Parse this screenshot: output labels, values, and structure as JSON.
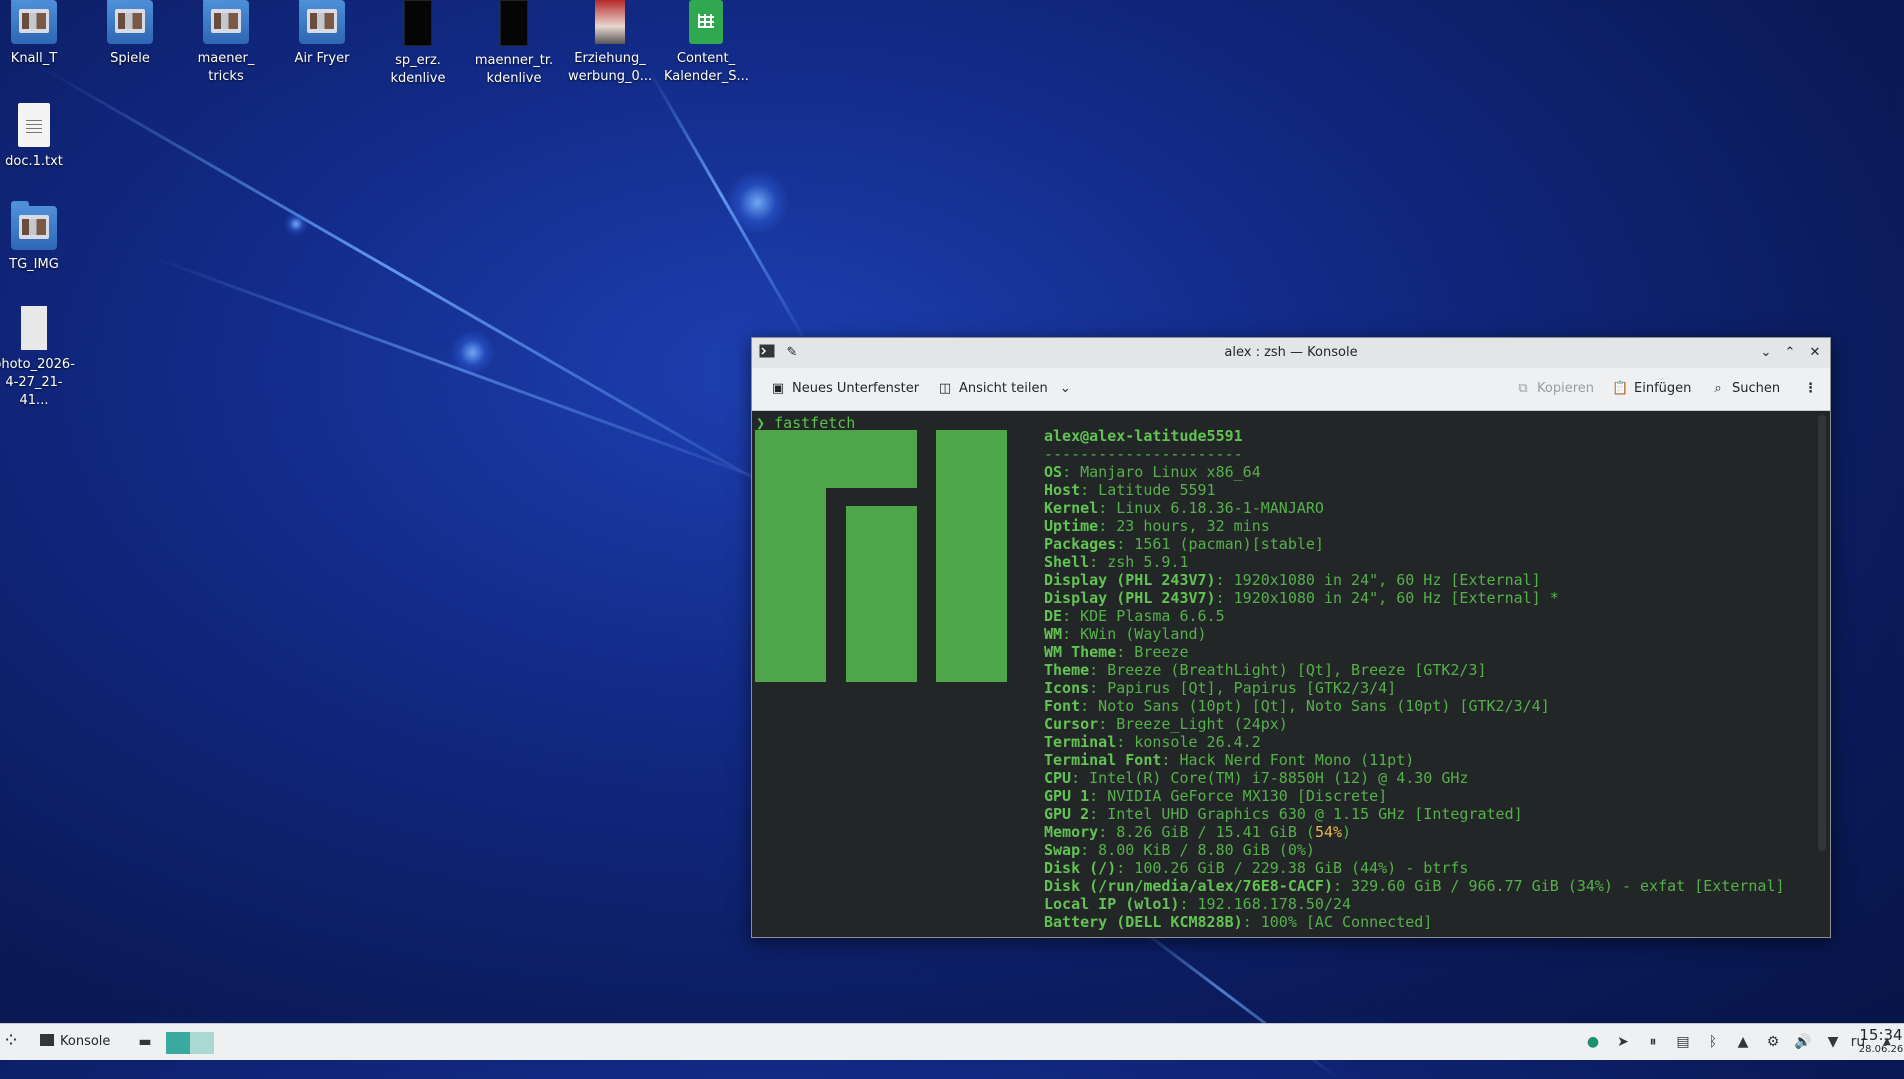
{
  "desktop": {
    "icons": [
      {
        "label": "Knall_T"
      },
      {
        "label": "Spiele"
      },
      {
        "label": "maener_ tricks"
      },
      {
        "label": "Air Fryer"
      },
      {
        "label": "sp_erz. kdenlive"
      },
      {
        "label": "maenner_tr. kdenlive"
      },
      {
        "label": "Erziehung_ werbung_0..."
      },
      {
        "label": "Content_ Kalender_S..."
      },
      {
        "label": "doc.1.txt"
      },
      {
        "label": "TG_IMG"
      },
      {
        "label": "photo_2026- 4-27_21-41..."
      }
    ]
  },
  "window": {
    "title": "alex : zsh — Konsole",
    "toolbar": {
      "new_tab": "Neues Unterfenster",
      "split_view": "Ansicht teilen",
      "copy": "Kopieren",
      "paste": "Einfügen",
      "search": "Suchen"
    }
  },
  "terminal": {
    "prompt_symbol": "❯",
    "command": "fastfetch",
    "user_host": "alex@alex-latitude5591",
    "separator": "----------------------",
    "lines": [
      {
        "key": "OS",
        "value": ": Manjaro Linux x86_64"
      },
      {
        "key": "Host",
        "value": ": Latitude 5591"
      },
      {
        "key": "Kernel",
        "value": ": Linux 6.18.36-1-MANJARO"
      },
      {
        "key": "Uptime",
        "value": ": 23 hours, 32 mins"
      },
      {
        "key": "Packages",
        "value": ": 1561 (pacman)[stable]"
      },
      {
        "key": "Shell",
        "value": ": zsh 5.9.1"
      },
      {
        "key": "Display (PHL 243V7)",
        "value": ": 1920x1080 in 24\", 60 Hz [External]"
      },
      {
        "key": "Display (PHL 243V7)",
        "value": ": 1920x1080 in 24\", 60 Hz [External] *"
      },
      {
        "key": "DE",
        "value": ": KDE Plasma 6.6.5"
      },
      {
        "key": "WM",
        "value": ": KWin (Wayland)"
      },
      {
        "key": "WM Theme",
        "value": ": Breeze"
      },
      {
        "key": "Theme",
        "value": ": Breeze (BreathLight) [Qt], Breeze [GTK2/3]"
      },
      {
        "key": "Icons",
        "value": ": Papirus [Qt], Papirus [GTK2/3/4]"
      },
      {
        "key": "Font",
        "value": ": Noto Sans (10pt) [Qt], Noto Sans (10pt) [GTK2/3/4]"
      },
      {
        "key": "Cursor",
        "value": ": Breeze_Light (24px)"
      },
      {
        "key": "Terminal",
        "value": ": konsole 26.4.2"
      },
      {
        "key": "Terminal Font",
        "value": ": Hack Nerd Font Mono (11pt)"
      },
      {
        "key": "CPU",
        "value": ": Intel(R) Core(TM) i7-8850H (12) @ 4.30 GHz"
      },
      {
        "key": "GPU 1",
        "value": ": NVIDIA GeForce MX130 [Discrete]"
      },
      {
        "key": "GPU 2",
        "value": ": Intel UHD Graphics 630 @ 1.15 GHz [Integrated]"
      },
      {
        "key": "Memory",
        "value": ": 8.26 GiB / 15.41 GiB (",
        "hl": "54%",
        "tail": ")"
      },
      {
        "key": "Swap",
        "value": ": 8.00 KiB / 8.80 GiB (0%)"
      },
      {
        "key": "Disk (/)",
        "value": ": 100.26 GiB / 229.38 GiB (44%) - btrfs"
      },
      {
        "key": "Disk (/run/media/alex/76E8-CACF)",
        "value": ": 329.60 GiB / 966.77 GiB (34%) - exfat [External]"
      },
      {
        "key": "Local IP (wlo1)",
        "value": ": 192.168.178.50/24"
      },
      {
        "key": "Battery (DELL KCM828B)",
        "value": ": 100% [AC Connected]"
      }
    ]
  },
  "taskbar": {
    "task_konsole": "Konsole",
    "keyboard_layout": "ru",
    "time": "15:34",
    "date": "28.06.26"
  },
  "colors": {
    "terminal_bg": "#232627",
    "terminal_green": "#5ac24a",
    "logo_green": "#4fa64a",
    "highlight": "#e8b74a"
  }
}
